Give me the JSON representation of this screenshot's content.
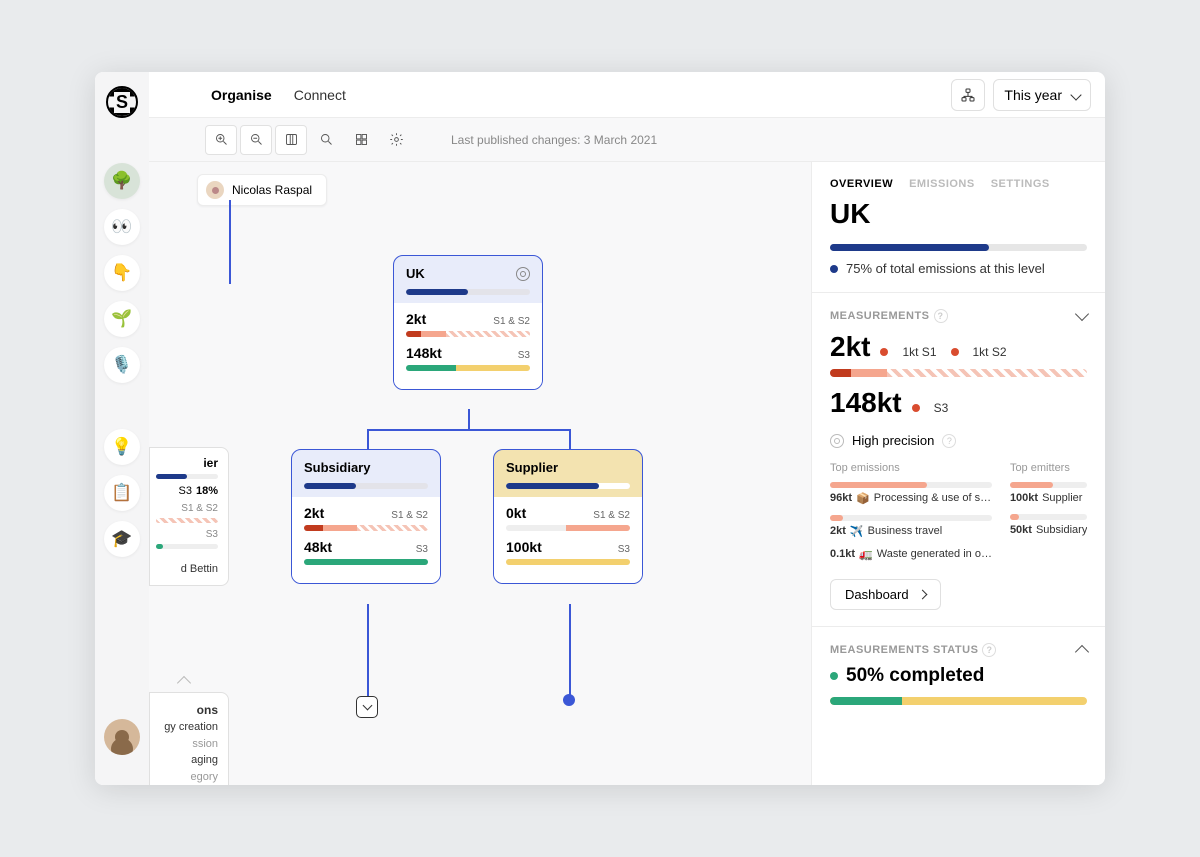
{
  "nav": {
    "organise": "Organise",
    "connect": "Connect",
    "year": "This year"
  },
  "toolbar": {
    "published": "Last published changes: 3 March 2021"
  },
  "user_chip": {
    "name": "Nicolas Raspal"
  },
  "rail": {
    "icons": [
      "🌳",
      "👀",
      "👇",
      "🌱",
      "🎙️"
    ],
    "icons2": [
      "💡",
      "📋",
      "🎓"
    ]
  },
  "canvas": {
    "uk": {
      "title": "UK",
      "s1s2": {
        "val": "2kt",
        "lab": "S1 & S2"
      },
      "s3": {
        "val": "148kt",
        "lab": "S3"
      }
    },
    "subsidiary": {
      "title": "Subsidiary",
      "s1s2": {
        "val": "2kt",
        "lab": "S1 & S2"
      },
      "s3": {
        "val": "48kt",
        "lab": "S3"
      }
    },
    "supplier": {
      "title": "Supplier",
      "s1s2": {
        "val": "0kt",
        "lab": "S1 & S2"
      },
      "s3": {
        "val": "100kt",
        "lab": "S3"
      }
    },
    "partial": {
      "title": "ier",
      "s3pct": "18%",
      "s3lab": "S3",
      "s1s2lab": "S1 & S2",
      "s3lab2": "S3",
      "name": "d Bettin"
    },
    "partial2": {
      "h": "ons",
      "l1": "gy creation",
      "l2": "ssion",
      "l3": "aging",
      "l4": "egory"
    }
  },
  "panel": {
    "tabs": {
      "overview": "OVERVIEW",
      "emissions": "EMISSIONS",
      "settings": "SETTINGS"
    },
    "title": "UK",
    "pct_line": "75% of total emissions at this level",
    "measurements": {
      "heading": "MEASUREMENTS",
      "v1": "2kt",
      "s1": "1kt S1",
      "s2": "1kt S2",
      "v2": "148kt",
      "s3": "S3",
      "hp": "High precision"
    },
    "top_emissions_h": "Top emissions",
    "top_emitters_h": "Top emitters",
    "emissions": [
      {
        "val": "96kt",
        "icon": "📦",
        "label": "Processing & use of s…",
        "w": "60%"
      },
      {
        "val": "2kt",
        "icon": "✈️",
        "label": "Business travel",
        "w": "8%"
      },
      {
        "val": "0.1kt",
        "icon": "🚛",
        "label": "Waste generated in o…",
        "w": "0%"
      }
    ],
    "emitters": [
      {
        "val": "100kt",
        "label": "Supplier",
        "w": "55%"
      },
      {
        "val": "50kt",
        "label": "Subsidiary",
        "w": "12%"
      }
    ],
    "dashboard": "Dashboard",
    "status": {
      "heading": "MEASUREMENTS STATUS",
      "pct": "50% completed"
    }
  }
}
